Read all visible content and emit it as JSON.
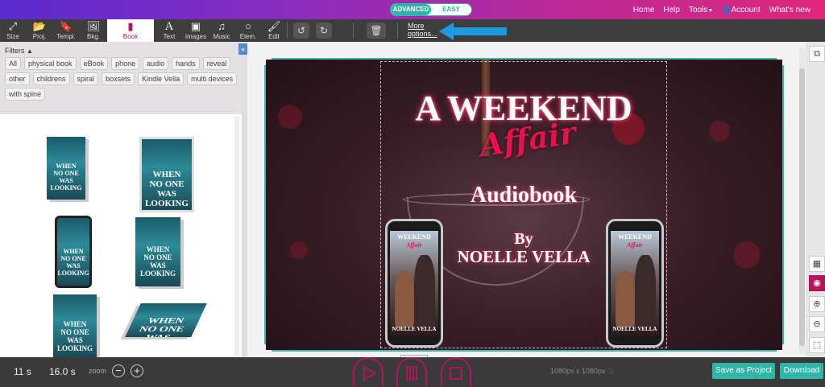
{
  "mode": {
    "advanced": "ADVANCED",
    "easy": "EASY"
  },
  "topnav": {
    "home": "Home",
    "help": "Help",
    "tools": "Tools",
    "account": "Account",
    "whats_new": "What's new"
  },
  "toolbar": {
    "size": "Size",
    "proj": "Proj.",
    "templ": "Templ.",
    "bkg": "Bkg.",
    "book": "Book",
    "text": "Text",
    "images": "Images",
    "music": "Music",
    "elem": "Elem.",
    "edit": "Edit",
    "more_options": "More options..."
  },
  "filters": {
    "title": "Filters",
    "chips": [
      "All",
      "physical book",
      "eBook",
      "phone",
      "audio",
      "hands",
      "reveal",
      "other",
      "childrens",
      "spiral",
      "boxsets",
      "Kindle Vella",
      "multi devices",
      "with spine"
    ]
  },
  "mockup_cover": {
    "l1": "WHEN",
    "l2": "NO ONE",
    "l3": "WAS",
    "l4": "LOOKING"
  },
  "canvas": {
    "title_line1": "A WEEKEND",
    "title_line2": "Affair",
    "title_line3": "Audiobook",
    "by": "By",
    "author": "NOELLE VELLA",
    "phone_title_a": "WEEKEND",
    "phone_title_b": "Affair",
    "phone_author": "NOELLE VELLA"
  },
  "bottombar": {
    "elapsed": "11 s",
    "duration": "16.0 s",
    "zoom_label": "zoom",
    "zoom_out": "−",
    "zoom_in": "+",
    "resolution": "1080px x 1080px",
    "save_project": "Save as Project",
    "download": "Download"
  },
  "colors": {
    "accent_teal": "#2fb5a8",
    "accent_magenta": "#b3145e",
    "arrow_blue": "#1e9be0"
  }
}
